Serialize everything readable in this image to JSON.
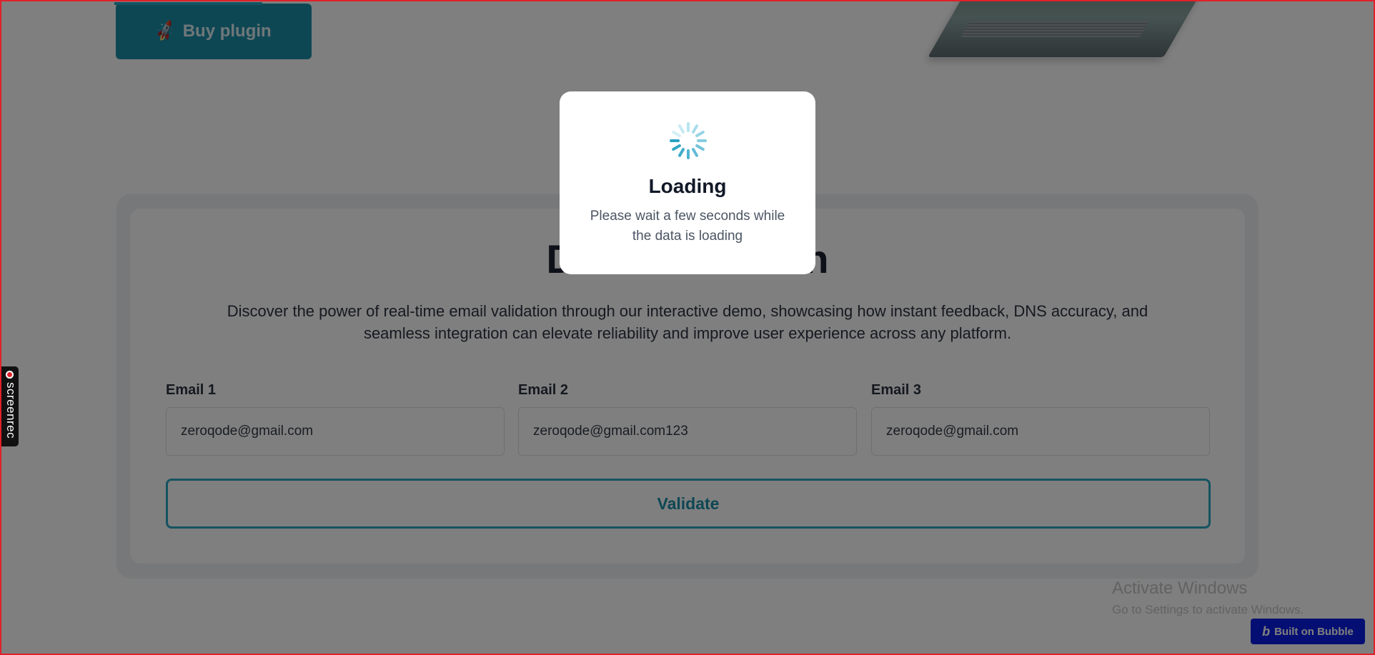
{
  "top_bar": {
    "buy_button_label": "Buy plugin"
  },
  "demo": {
    "title": "Demonstration",
    "description": "Discover the power of real-time email validation through our interactive demo, showcasing how instant feedback, DNS accuracy, and seamless integration can elevate reliability and improve user experience across any platform.",
    "fields": [
      {
        "label": "Email 1",
        "value": "zeroqode@gmail.com"
      },
      {
        "label": "Email 2",
        "value": "zeroqode@gmail.com123"
      },
      {
        "label": "Email 3",
        "value": "zeroqode@gmail.com"
      }
    ],
    "validate_label": "Validate"
  },
  "modal": {
    "title": "Loading",
    "message": "Please wait a few seconds while the data is loading"
  },
  "screenrec": {
    "label": "screenrec"
  },
  "windows_watermark": {
    "title": "Activate Windows",
    "subtitle": "Go to Settings to activate Windows."
  },
  "bubble_badge": {
    "label": "Built on Bubble"
  },
  "colors": {
    "accent": "#2aa6c2",
    "accent_dark": "#1d8fa9",
    "overlay": "rgba(0,0,0,0.5)",
    "bubble_blue": "#0b1fe6",
    "frame_red": "#e0212a"
  },
  "icons": {
    "buy_button": "rocket-icon",
    "modal": "loading-spinner-icon",
    "screenrec": "record-dot-icon",
    "bubble": "bubble-logo-icon"
  }
}
